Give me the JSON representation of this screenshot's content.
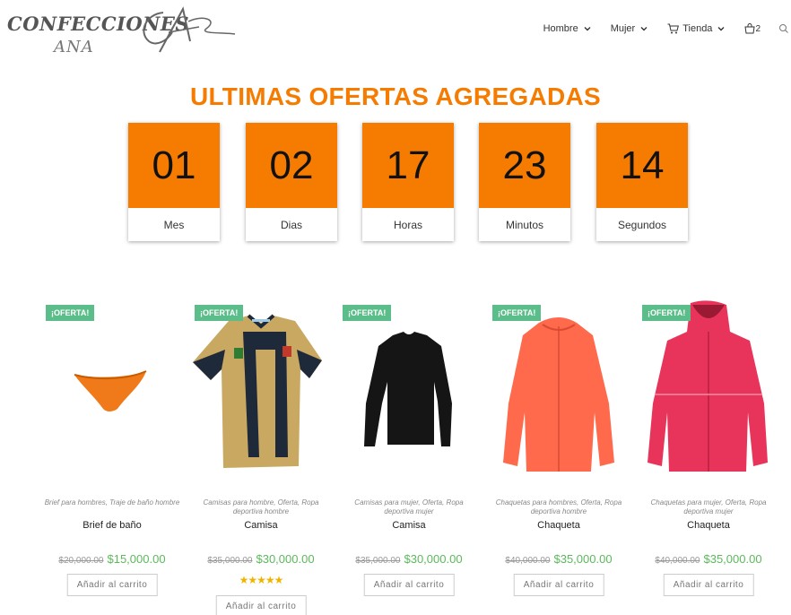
{
  "brand": {
    "line1": "CONFECCIONES",
    "line2": "ANA"
  },
  "nav": {
    "items": [
      {
        "label": "Hombre"
      },
      {
        "label": "Mujer"
      },
      {
        "label": "Tienda"
      }
    ],
    "cart_count": "2"
  },
  "title": "ULTIMAS OFERTAS AGREGADAS",
  "countdown": [
    {
      "value": "01",
      "label": "Mes"
    },
    {
      "value": "02",
      "label": "Dias"
    },
    {
      "value": "17",
      "label": "Horas"
    },
    {
      "value": "23",
      "label": "Minutos"
    },
    {
      "value": "14",
      "label": "Segundos"
    }
  ],
  "products": [
    {
      "badge": "¡OFERTA!",
      "categories": "Brief para hombres, Traje de baño hombre",
      "name": "Brief de baño",
      "old_price": "$20,000.00",
      "price": "$15,000.00",
      "rating": "",
      "button": "Añadir al carrito",
      "image_icon": "swim-brief-icon"
    },
    {
      "badge": "¡OFERTA!",
      "categories": "Camisas para hombre, Oferta, Ropa deportiva hombre",
      "name": "Camisa",
      "old_price": "$35,000.00",
      "price": "$30,000.00",
      "rating": "★★★★★",
      "button": "Añadir al carrito",
      "image_icon": "jersey-icon"
    },
    {
      "badge": "¡OFERTA!",
      "categories": "Camisas para mujer, Oferta, Ropa deportiva mujer",
      "name": "Camisa",
      "old_price": "$35,000.00",
      "price": "$30,000.00",
      "rating": "",
      "button": "Añadir al carrito",
      "image_icon": "long-sleeve-shirt-icon"
    },
    {
      "badge": "¡OFERTA!",
      "categories": "Chaquetas para hombres, Oferta, Ropa deportiva hombre",
      "name": "Chaqueta",
      "old_price": "$40,000.00",
      "price": "$35,000.00",
      "rating": "",
      "button": "Añadir al carrito",
      "image_icon": "jacket-icon"
    },
    {
      "badge": "¡OFERTA!",
      "categories": "Chaquetas para mujer, Oferta, Ropa deportiva mujer",
      "name": "Chaqueta",
      "old_price": "$40,000.00",
      "price": "$35,000.00",
      "rating": "",
      "button": "Añadir al carrito",
      "image_icon": "jacket-icon"
    }
  ],
  "colors": {
    "accent": "#f57c00",
    "badge": "#5bbd8a",
    "price": "#5cb85c"
  }
}
